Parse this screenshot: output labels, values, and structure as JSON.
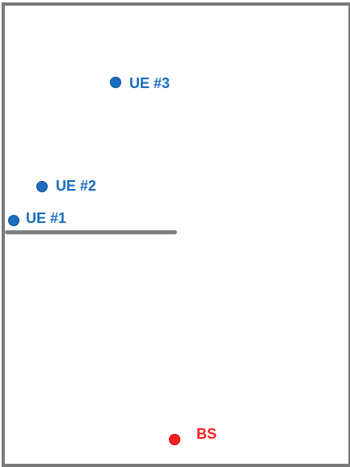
{
  "nodes": {
    "ue1": {
      "label": "UE #1"
    },
    "ue2": {
      "label": "UE #2"
    },
    "ue3": {
      "label": "UE #3"
    },
    "bs": {
      "label": "BS"
    }
  },
  "colors": {
    "ue": "#1a6dbf",
    "bs": "#ff1f1f",
    "wall": "#7f7f7f"
  }
}
